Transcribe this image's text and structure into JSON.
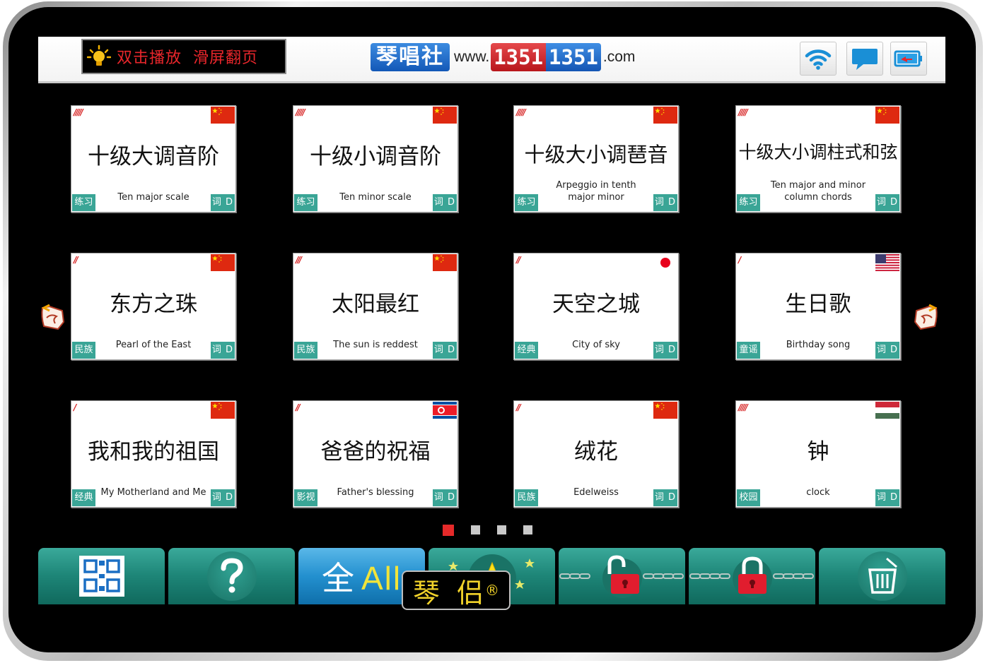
{
  "header": {
    "hint_text": "双击播放  滑屏翻页",
    "logo_cn": "琴唱社",
    "logo_www": "www.",
    "logo_num_red": "1351",
    "logo_num_blue": "1351",
    "logo_com": ".com",
    "icons": [
      "wifi-icon",
      "message-icon",
      "battery-icon"
    ]
  },
  "cards": [
    {
      "level": "/////",
      "flag": "china",
      "title": "十级大调音阶",
      "subtitle": "Ten major scale",
      "category": "练习",
      "lyrics": "词 D"
    },
    {
      "level": "/////",
      "flag": "china",
      "title": "十级小调音阶",
      "subtitle": "Ten minor scale",
      "category": "练习",
      "lyrics": "词 D"
    },
    {
      "level": "/////",
      "flag": "china",
      "title": "十级大小调琶音",
      "subtitle": "Arpeggio in tenth major minor",
      "category": "练习",
      "lyrics": "词 D"
    },
    {
      "level": "/////",
      "flag": "china",
      "title": "十级大小调柱式和弦",
      "subtitle": "Ten major and minor column chords",
      "category": "练习",
      "lyrics": "词 D"
    },
    {
      "level": "//",
      "flag": "china",
      "title": "东方之珠",
      "subtitle": "Pearl of the East",
      "category": "民族",
      "lyrics": "词 D"
    },
    {
      "level": "///",
      "flag": "china",
      "title": "太阳最红",
      "subtitle": "The sun is reddest",
      "category": "民族",
      "lyrics": "词 D"
    },
    {
      "level": "//",
      "flag": "japan",
      "title": "天空之城",
      "subtitle": "City of sky",
      "category": "经典",
      "lyrics": "词 D"
    },
    {
      "level": "/",
      "flag": "usa",
      "title": "生日歌",
      "subtitle": "Birthday song",
      "category": "童谣",
      "lyrics": "词 D"
    },
    {
      "level": "/",
      "flag": "china",
      "title": "我和我的祖国",
      "subtitle": "My Motherland and Me",
      "category": "经典",
      "lyrics": "词 D"
    },
    {
      "level": "//",
      "flag": "north-korea",
      "title": "爸爸的祝福",
      "subtitle": "Father's blessing",
      "category": "影视",
      "lyrics": "词 D"
    },
    {
      "level": "//",
      "flag": "china",
      "title": "绒花",
      "subtitle": "Edelweiss",
      "category": "民族",
      "lyrics": "词 D"
    },
    {
      "level": "/////",
      "flag": "hungary",
      "title": "钟",
      "subtitle": "clock",
      "category": "校园",
      "lyrics": "词 D"
    }
  ],
  "pagination": {
    "total": 4,
    "active": 0
  },
  "toolbar": {
    "all_cn": "全",
    "all_en": "All",
    "buttons": [
      "qr-code",
      "help",
      "all",
      "favorites",
      "unlock-easy",
      "unlock-hard",
      "trash"
    ]
  },
  "brand": {
    "name": "琴 侣",
    "mark": "®"
  },
  "colors": {
    "accent": "#1e8678",
    "active": "#2390cf",
    "flag_red": "#de2910",
    "category": "#3aa596"
  }
}
